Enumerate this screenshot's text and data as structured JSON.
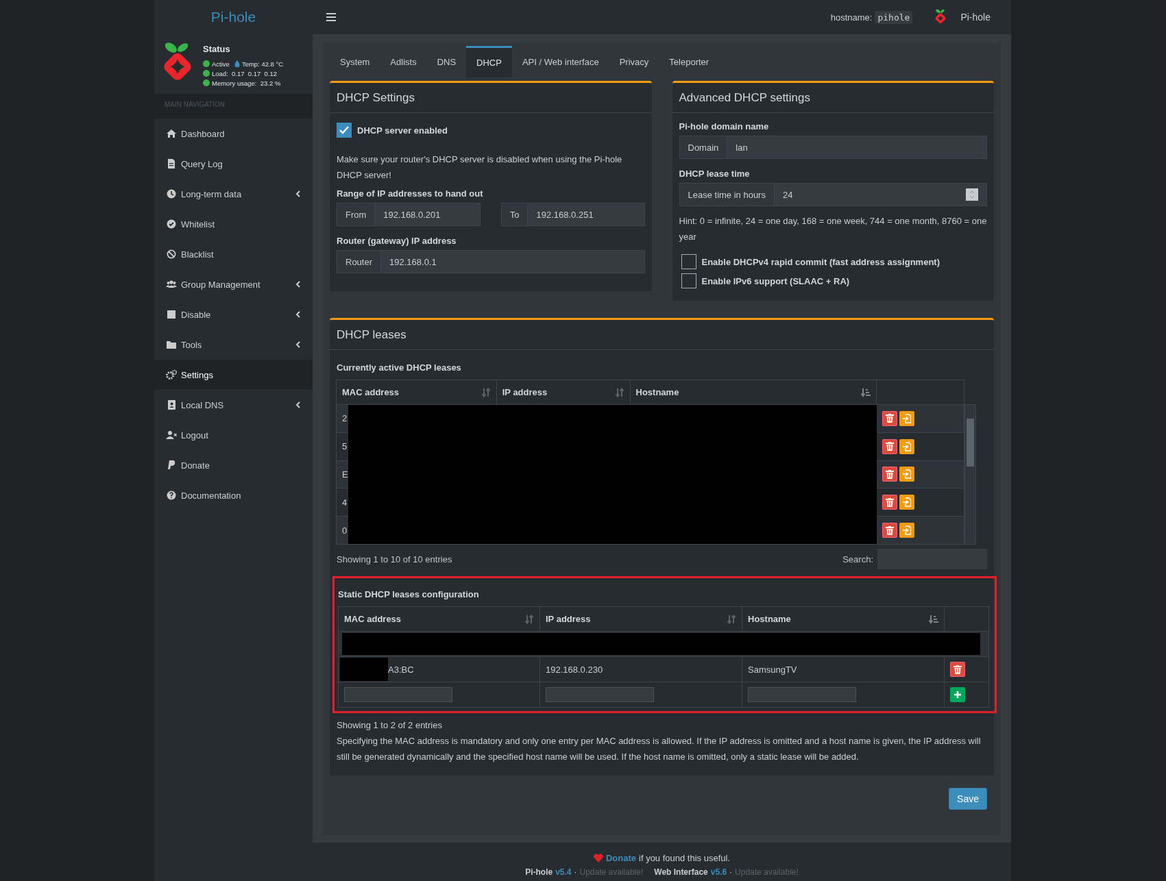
{
  "header": {
    "brand": "Pi-hole",
    "hostname_label": "hostname:",
    "hostname": "pihole",
    "user": "Pi-hole"
  },
  "status": {
    "title": "Status",
    "active": "Active",
    "temp": "Temp: 42.8 °C",
    "load": "Load:  0.17  0.17  0.12",
    "memory": "Memory usage:  23.2 %"
  },
  "sidebar": {
    "header": "MAIN NAVIGATION",
    "items": [
      {
        "label": "Dashboard",
        "selected": false,
        "submenu": false
      },
      {
        "label": "Query Log",
        "selected": false,
        "submenu": false
      },
      {
        "label": "Long-term data",
        "selected": false,
        "submenu": true
      },
      {
        "label": "Whitelist",
        "selected": false,
        "submenu": false
      },
      {
        "label": "Blacklist",
        "selected": false,
        "submenu": false
      },
      {
        "label": "Group Management",
        "selected": false,
        "submenu": true
      },
      {
        "label": "Disable",
        "selected": false,
        "submenu": true
      },
      {
        "label": "Tools",
        "selected": false,
        "submenu": true
      },
      {
        "label": "Settings",
        "selected": true,
        "submenu": false
      },
      {
        "label": "Local DNS",
        "selected": false,
        "submenu": true
      },
      {
        "label": "Logout",
        "selected": false,
        "submenu": false
      },
      {
        "label": "Donate",
        "selected": false,
        "submenu": false
      },
      {
        "label": "Documentation",
        "selected": false,
        "submenu": false
      }
    ]
  },
  "tabs": [
    {
      "label": "System",
      "selected": false
    },
    {
      "label": "Adlists",
      "selected": false
    },
    {
      "label": "DNS",
      "selected": false
    },
    {
      "label": "DHCP",
      "selected": true
    },
    {
      "label": "API / Web interface",
      "selected": false
    },
    {
      "label": "Privacy",
      "selected": false
    },
    {
      "label": "Teleporter",
      "selected": false
    }
  ],
  "dhcp_settings": {
    "title": "DHCP Settings",
    "server_enabled": {
      "label": "DHCP server enabled",
      "checked": true
    },
    "note": "Make sure your router's DHCP server is disabled when using the Pi-hole DHCP server!",
    "range_label": "Range of IP addresses to hand out",
    "from": {
      "addon": "From",
      "value": "192.168.0.201"
    },
    "to": {
      "addon": "To",
      "value": "192.168.0.251"
    },
    "router_label": "Router (gateway) IP address",
    "router": {
      "addon": "Router",
      "value": "192.168.0.1"
    }
  },
  "advanced": {
    "title": "Advanced DHCP settings",
    "domain_label": "Pi-hole domain name",
    "domain": {
      "addon": "Domain",
      "value": "lan"
    },
    "lease_label": "DHCP lease time",
    "lease": {
      "addon": "Lease time in hours",
      "value": "24"
    },
    "hint": "Hint: 0 = infinite, 24 = one day, 168 = one week, 744 = one month, 8760 = one year",
    "options": [
      {
        "label": "Enable DHCPv4 rapid commit (fast address assignment)",
        "checked": false
      },
      {
        "label": "Enable IPv6 support (SLAAC + RA)",
        "checked": false
      }
    ]
  },
  "leases": {
    "title": "DHCP leases",
    "active": {
      "heading": "Currently active DHCP leases",
      "columns": [
        {
          "label": "MAC address",
          "sorted": false
        },
        {
          "label": "IP address",
          "sorted": false
        },
        {
          "label": "Hostname",
          "sorted": true
        }
      ],
      "rows": [
        {
          "mac": "2"
        },
        {
          "mac": "5"
        },
        {
          "mac": "E"
        },
        {
          "mac": "4"
        },
        {
          "mac": "0"
        }
      ],
      "info": "Showing 1 to 10 of 10 entries",
      "search_label": "Search:"
    },
    "static": {
      "heading": "Static DHCP leases configuration",
      "highlighted": true,
      "columns": [
        {
          "label": "MAC address",
          "sorted": false
        },
        {
          "label": "IP address",
          "sorted": false
        },
        {
          "label": "Hostname",
          "sorted": true
        }
      ],
      "rows": [
        {
          "kind": "redacted"
        },
        {
          "kind": "lease",
          "mac": "A3:BC",
          "mac_redacted": true,
          "ip": "192.168.0.230",
          "hostname": "SamsungTV"
        }
      ],
      "info": "Showing 1 to 2 of 2 entries",
      "note": "Specifying the MAC address is mandatory and only one entry per MAC address is allowed. If the IP address is omitted and a host name is given, the IP address will still be generated dynamically and the specified host name will be used. If the host name is omitted, only a static lease will be added."
    }
  },
  "save": "Save",
  "footer": {
    "donate_link": "Donate",
    "donate_text": "if you found this useful.",
    "versions": [
      {
        "name": "Pi-hole",
        "version": "v5.4",
        "sep": "·",
        "update": "Update available!"
      },
      {
        "name": "Web Interface",
        "version": "v5.6",
        "sep": "·",
        "update": "Update available!"
      }
    ]
  }
}
